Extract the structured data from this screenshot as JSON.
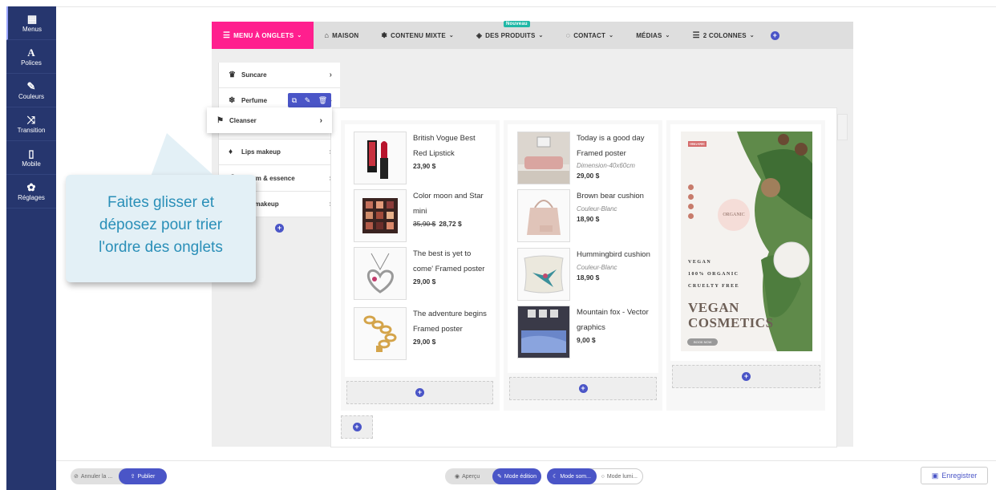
{
  "sidebar": {
    "items": [
      {
        "label": "Menus",
        "icon": "grid-icon"
      },
      {
        "label": "Polices",
        "icon": "font-icon"
      },
      {
        "label": "Couleurs",
        "icon": "brush-icon"
      },
      {
        "label": "Transition",
        "icon": "shuffle-icon"
      },
      {
        "label": "Mobile",
        "icon": "mobile-icon"
      },
      {
        "label": "Réglages",
        "icon": "gear-icon"
      }
    ]
  },
  "menubar": {
    "tabs": [
      {
        "label": "MENU À ONGLETS"
      },
      {
        "label": "MAISON"
      },
      {
        "label": "CONTENU MIXTE"
      },
      {
        "label": "DES PRODUITS",
        "badge": "Nouveau"
      },
      {
        "label": "CONTACT"
      },
      {
        "label": "MÉDIAS"
      },
      {
        "label": "2 COLONNES"
      }
    ]
  },
  "tabs": {
    "items": [
      {
        "label": "Suncare"
      },
      {
        "label": "Perfume"
      },
      {
        "label": "Cleanser"
      },
      {
        "label": "Lips makeup"
      },
      {
        "label": "Serum & essence"
      },
      {
        "label": "Eye makeup"
      }
    ]
  },
  "products": {
    "col1": [
      {
        "name": "British Vogue Best Red Lipstick",
        "price": "23,90 $"
      },
      {
        "name": "Color moon and Star mini",
        "old_price": "35,90 $",
        "price": "28,72 $"
      },
      {
        "name": "The best is yet to come' Framed poster",
        "price": "29,00 $"
      },
      {
        "name": "The adventure begins Framed poster",
        "price": "29,00 $"
      }
    ],
    "col2": [
      {
        "name": "Today is a good day Framed poster",
        "attr": "Dimension-40x60cm",
        "price": "29,00 $"
      },
      {
        "name": "Brown bear cushion",
        "attr": "Couleur-Blanc",
        "price": "18,90 $"
      },
      {
        "name": "Hummingbird cushion",
        "attr": "Couleur-Blanc",
        "price": "18,90 $"
      },
      {
        "name": "Mountain fox - Vector graphics",
        "price": "9,00 $"
      }
    ]
  },
  "banner": {
    "logo": "ORGANIC",
    "circle": "ORGANIC",
    "line1": "VEGAN",
    "line2": "100% ORGANIC",
    "line3": "CRUELTY FREE",
    "big1": "VEGAN",
    "big2": "COSMETICS",
    "button": "BOOK NOW"
  },
  "callout": {
    "text": "Faites glisser et déposez pour trier l'ordre des onglets"
  },
  "bottombar": {
    "undo": "Annuler la ...",
    "publish": "Publier",
    "preview": "Aperçu",
    "edit_mode": "Mode édition",
    "dark_mode": "Mode som...",
    "light_mode": "Mode lumi...",
    "save": "Enregistrer"
  },
  "colors": {
    "sidebar": "#26366e",
    "accent": "#4a55c7",
    "active_tab": "#ff1f8e",
    "badge": "#1fb8a6",
    "callout_text": "#2a8fb8"
  }
}
